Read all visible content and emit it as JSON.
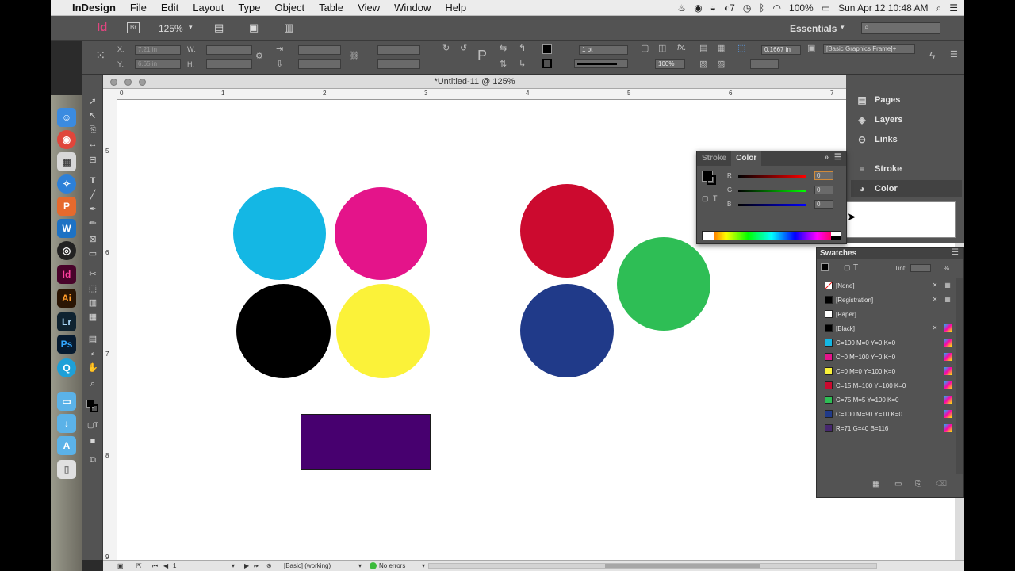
{
  "menubar": {
    "apple_icon": "apple-icon",
    "app": "InDesign",
    "items": [
      "File",
      "Edit",
      "Layout",
      "Type",
      "Object",
      "Table",
      "View",
      "Window",
      "Help"
    ],
    "notification_count": "7",
    "battery": "100%",
    "clock": "Sun Apr 12  10:48 AM"
  },
  "appbar": {
    "app_logo": "Id",
    "bridge_logo": "Br",
    "zoom": "125%",
    "workspace": "Essentials",
    "search_placeholder": ""
  },
  "control": {
    "x_label": "X:",
    "x_value": "7.21 in",
    "y_label": "Y:",
    "y_value": "6.65 in",
    "w_label": "W:",
    "h_label": "H:",
    "stroke_weight": "1 pt",
    "scale_value": "100%",
    "offset_value": "0.1667 in",
    "object_style": "[Basic Graphics Frame]+"
  },
  "document": {
    "title": "*Untitled-11 @ 125%",
    "hruler": [
      "0",
      "1",
      "2",
      "3",
      "4",
      "5",
      "6",
      "7"
    ],
    "vruler": [
      "5",
      "6",
      "7",
      "8",
      "9"
    ],
    "shapes": [
      {
        "name": "cyan",
        "color": "#14b7e4"
      },
      {
        "name": "magenta",
        "color": "#e4148a"
      },
      {
        "name": "black",
        "color": "#000000"
      },
      {
        "name": "yellow",
        "color": "#fbf239"
      },
      {
        "name": "red",
        "color": "#cc0a2f"
      },
      {
        "name": "green",
        "color": "#2ebe55"
      },
      {
        "name": "blue",
        "color": "#203a89"
      },
      {
        "name": "purple",
        "color": "#47006f"
      }
    ]
  },
  "status": {
    "page": "1",
    "preflight_profile": "[Basic] (working)",
    "errors": "No errors"
  },
  "panels": {
    "dock": {
      "items": [
        "Pages",
        "Layers",
        "Links",
        "Stroke",
        "Color"
      ]
    },
    "color": {
      "tabs": [
        "Stroke",
        "Color"
      ],
      "channels": [
        "R",
        "G",
        "B"
      ],
      "values": [
        "0",
        "0",
        "0"
      ]
    },
    "swatches": {
      "title": "Swatches",
      "tint_label": "Tint:",
      "tint_unit": "%",
      "rows": [
        {
          "name": "[None]",
          "color": "none"
        },
        {
          "name": "[Registration]",
          "color": "#000000"
        },
        {
          "name": "[Paper]",
          "color": "#ffffff"
        },
        {
          "name": "[Black]",
          "color": "#000000"
        },
        {
          "name": "C=100 M=0 Y=0 K=0",
          "color": "#14b7e4"
        },
        {
          "name": "C=0 M=100 Y=0 K=0",
          "color": "#e4148a"
        },
        {
          "name": "C=0 M=0 Y=100 K=0",
          "color": "#fbf239"
        },
        {
          "name": "C=15 M=100 Y=100 K=0",
          "color": "#cc0a2f"
        },
        {
          "name": "C=75 M=5 Y=100 K=0",
          "color": "#2ebe55"
        },
        {
          "name": "C=100 M=90 Y=10 K=0",
          "color": "#203a89"
        },
        {
          "name": "R=71 G=40 B=116",
          "color": "#47286f"
        }
      ]
    }
  }
}
